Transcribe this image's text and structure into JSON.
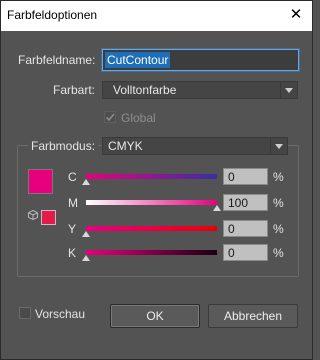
{
  "window": {
    "title": "Farbfeldoptionen",
    "close_glyph": "✕"
  },
  "name_field": {
    "label": "Farbfeldname:",
    "value": "CutContour"
  },
  "color_type": {
    "label": "Farbart:",
    "value": "Volltonfarbe"
  },
  "global": {
    "label": "Global",
    "checked": true
  },
  "color_mode": {
    "label": "Farbmodus:",
    "value": "CMYK"
  },
  "swatch_color": "#e6007e",
  "channels": [
    {
      "label": "C",
      "value": "0",
      "unit": "%",
      "level": 0,
      "gradient": [
        "#e6007e",
        "#3a2fa0"
      ]
    },
    {
      "label": "M",
      "value": "100",
      "unit": "%",
      "level": 1.0,
      "gradient": [
        "#ffffff",
        "#e6007e"
      ]
    },
    {
      "label": "Y",
      "value": "0",
      "unit": "%",
      "level": 0,
      "gradient": [
        "#e6007e",
        "#e6000a"
      ]
    },
    {
      "label": "K",
      "value": "0",
      "unit": "%",
      "level": 0,
      "gradient": [
        "#e6007e",
        "#1a0010"
      ]
    }
  ],
  "preview": {
    "label": "Vorschau",
    "checked": false
  },
  "buttons": {
    "ok": "OK",
    "cancel": "Abbrechen"
  }
}
